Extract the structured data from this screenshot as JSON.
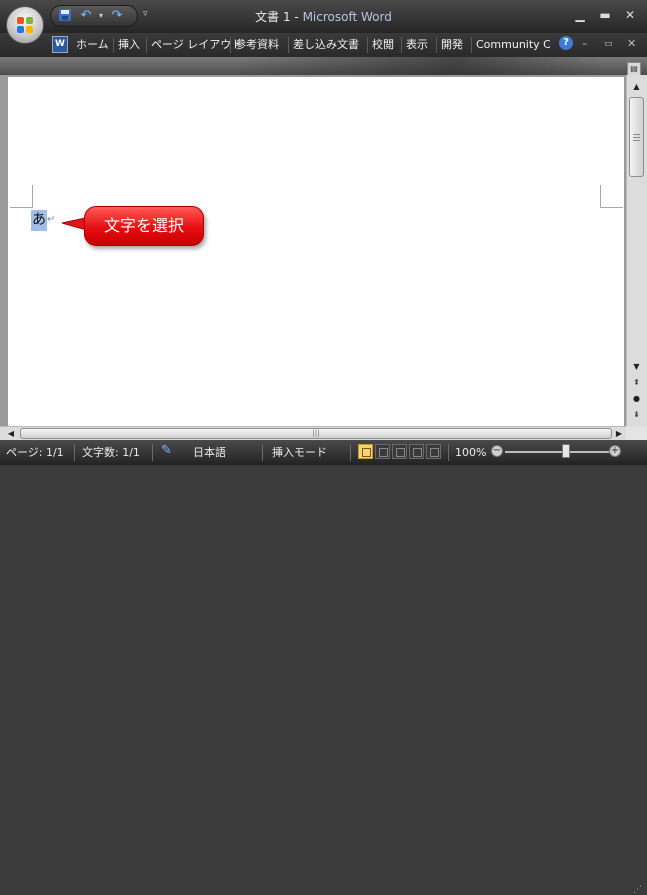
{
  "titlebar": {
    "document_title": "文書 1",
    "separator": " - ",
    "app_name": "Microsoft Word",
    "qat_icons": [
      "save-icon",
      "undo-icon",
      "redo-icon"
    ],
    "window_controls": [
      "minimize",
      "maximize",
      "close"
    ]
  },
  "ribbon": {
    "tabs": [
      "ホーム",
      "挿入",
      "ページ レイアウト",
      "参考資料",
      "差し込み文書",
      "校閲",
      "表示",
      "開発",
      "Community Cl"
    ],
    "help_label": "?"
  },
  "document": {
    "selected_text": "あ",
    "paragraph_mark": "↵",
    "callout_text": "文字を選択"
  },
  "statusbar": {
    "page": "ページ: 1/1",
    "word_count": "文字数: 1/1",
    "language": "日本語",
    "mode": "挿入モード",
    "zoom": "100%",
    "zoom_level": 100,
    "active_view": "print-layout"
  },
  "colors": {
    "callout": "#e60e12",
    "selection": "#9fbde6",
    "chrome_dark": "#2a2a2a"
  }
}
